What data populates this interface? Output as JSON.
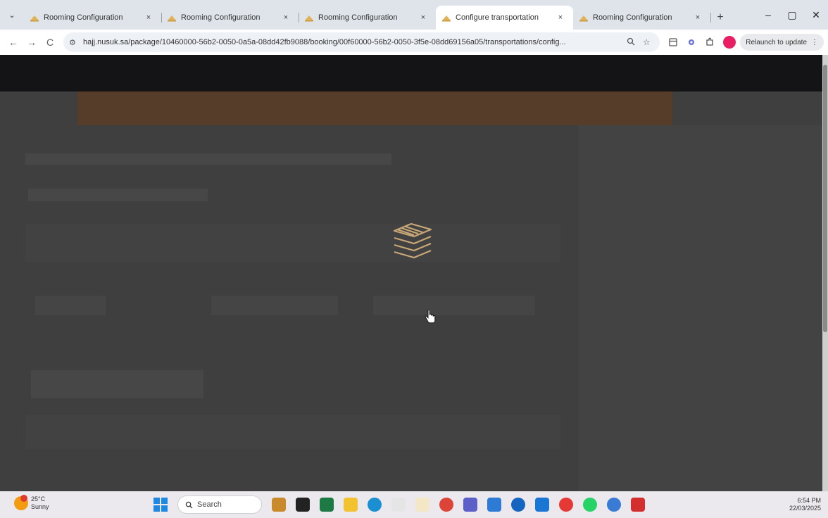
{
  "browser": {
    "tab_search_icon": "chevron-down",
    "tabs": [
      {
        "title": "Rooming Configuration",
        "active": false
      },
      {
        "title": "Rooming Configuration",
        "active": false
      },
      {
        "title": "Rooming Configuration",
        "active": false
      },
      {
        "title": "Configure transportation",
        "active": true
      },
      {
        "title": "Rooming Configuration",
        "active": false
      }
    ],
    "tab_close": "×",
    "new_tab": "+",
    "window": {
      "minimize": "–",
      "maximize": "▢",
      "close": "✕"
    },
    "toolbar": {
      "back": "←",
      "forward": "→",
      "reload": "C",
      "url": "hajj.nusuk.sa/package/10460000-56b2-0050-0a5a-08dd42fb9088/booking/00f60000-56b2-0050-3f5e-08dd69156a05/transportations/config...",
      "zoom_icon": "magnifier",
      "star": "☆",
      "relaunch_label": "Relaunch to update",
      "menu": "⋮"
    }
  },
  "page": {
    "state": "loading",
    "loader_icon": "stacked-layers-icon",
    "overlay_color": "#3f3f3f",
    "accent_color": "#c9a877"
  },
  "taskbar": {
    "weather_temp": "25°C",
    "weather_desc": "Sunny",
    "search_placeholder": "Search",
    "time": "6:54 PM",
    "date": "22/03/2025"
  }
}
